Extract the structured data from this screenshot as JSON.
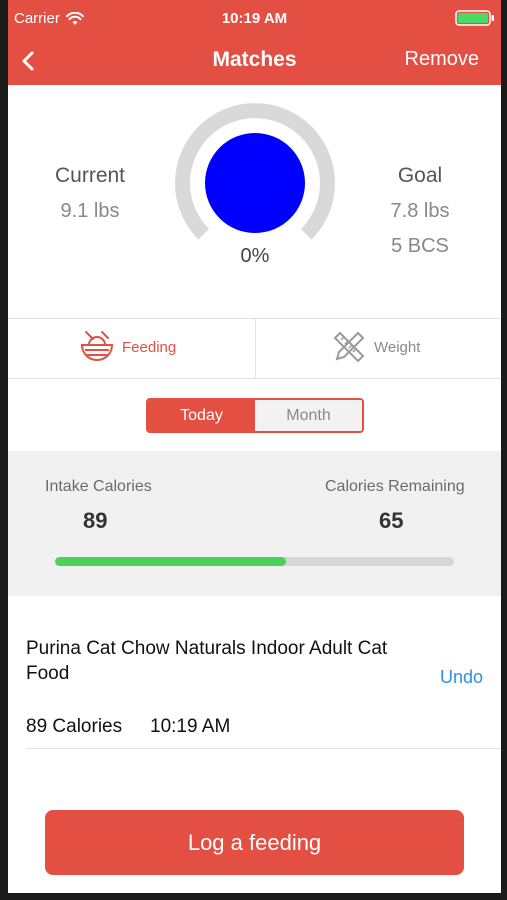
{
  "status_bar": {
    "carrier": "Carrier",
    "time": "10:19 AM"
  },
  "nav": {
    "title": "Matches",
    "right_action": "Remove",
    "back_icon": "chevron-left-icon"
  },
  "progress": {
    "current_label": "Current",
    "current_weight": "9.1 lbs",
    "goal_label": "Goal",
    "goal_weight": "7.8 lbs",
    "goal_bcs": "5 BCS",
    "percent_text": "0%"
  },
  "tabs": [
    {
      "label": "Feeding",
      "icon": "food-bowl-icon",
      "active": true
    },
    {
      "label": "Weight",
      "icon": "ruler-pencil-icon",
      "active": false
    }
  ],
  "segment": {
    "options": [
      "Today",
      "Month"
    ],
    "selected": "Today"
  },
  "calories": {
    "intake_label": "Intake Calories",
    "intake_value": "89",
    "remaining_label": "Calories Remaining",
    "remaining_value": "65",
    "intake_fraction": 0.578
  },
  "feeding_entry": {
    "food_name": "Purina Cat Chow Naturals Indoor Adult Cat Food",
    "calories": "89 Calories",
    "time": "10:19 AM",
    "undo_label": "Undo"
  },
  "log_button": "Log a feeding",
  "colors": {
    "accent": "#e34f43",
    "progress_green": "#4cd25b",
    "link_blue": "#2f8fe6",
    "gauge_center": "#0000ff"
  }
}
